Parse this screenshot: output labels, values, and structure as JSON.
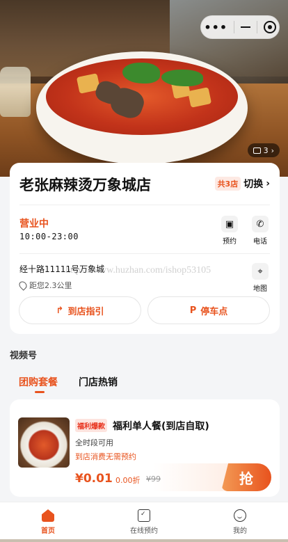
{
  "store": {
    "name": "老张麻辣烫万象城店",
    "total_badge": "共3店",
    "switch_label": "切换",
    "photo_count": "3",
    "status": "营业中",
    "hours": "10:00-23:00",
    "actions": {
      "reserve": "预约",
      "phone": "电话",
      "map": "地图"
    },
    "address": "经十路11111号万象城",
    "distance": "距您2.3公里",
    "guide_button": "到店指引",
    "parking_button": "停车点"
  },
  "watermark": "https://www.huzhan.com/ishop53105",
  "section": {
    "video_title": "视频号"
  },
  "tabs": [
    {
      "label": "团购套餐",
      "active": true
    },
    {
      "label": "门店热销",
      "active": false
    }
  ],
  "deal": {
    "tag": "福利爆款",
    "name": "福利单人餐(到店自取)",
    "subtitle": "全时段可用",
    "note": "到店消费无需预约",
    "price": "¥0.01",
    "discount": "0.00折",
    "original_price": "¥99",
    "grab_label": "抢"
  },
  "bottom_nav": [
    {
      "label": "首页",
      "icon": "home-icon",
      "active": true
    },
    {
      "label": "在线预约",
      "icon": "calendar-check-icon",
      "active": false
    },
    {
      "label": "我的",
      "icon": "smile-icon",
      "active": false
    }
  ],
  "colors": {
    "accent": "#e8531e",
    "background": "#f4f5f7"
  }
}
